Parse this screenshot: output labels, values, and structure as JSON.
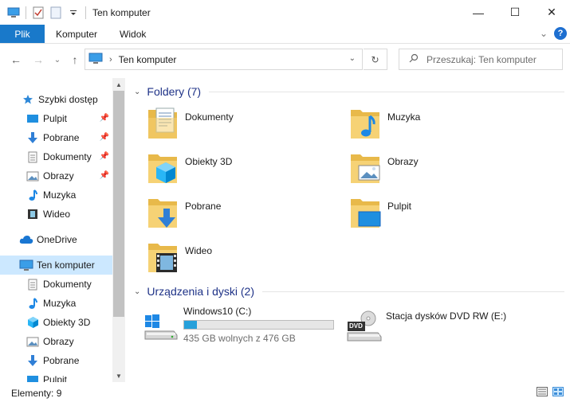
{
  "window": {
    "title": "Ten komputer",
    "min": "—",
    "max": "☐",
    "close": "✕"
  },
  "ribbon": {
    "tabs": [
      "Plik",
      "Komputer",
      "Widok"
    ],
    "collapse": "⌄",
    "help": "?"
  },
  "nav": {
    "back": "←",
    "forward": "→",
    "recent": "⌄",
    "up": "↑",
    "breadcrumb_sep": "›",
    "path": "Ten komputer",
    "dropdown": "⌄",
    "refresh": "↻",
    "search_placeholder": "Przeszukaj: Ten komputer"
  },
  "sidebar": {
    "items": [
      {
        "label": "Szybki dostęp",
        "icon": "star-icon",
        "pinned": false
      },
      {
        "label": "Pulpit",
        "icon": "desktop-icon",
        "pinned": true
      },
      {
        "label": "Pobrane",
        "icon": "download-icon",
        "pinned": true
      },
      {
        "label": "Dokumenty",
        "icon": "document-icon",
        "pinned": true
      },
      {
        "label": "Obrazy",
        "icon": "pictures-icon",
        "pinned": true
      },
      {
        "label": "Muzyka",
        "icon": "music-icon",
        "pinned": false
      },
      {
        "label": "Wideo",
        "icon": "video-icon",
        "pinned": false
      },
      {
        "label": "OneDrive",
        "icon": "cloud-icon",
        "pinned": false
      },
      {
        "label": "Ten komputer",
        "icon": "computer-icon",
        "pinned": false,
        "selected": true
      },
      {
        "label": "Dokumenty",
        "icon": "document-icon",
        "pinned": false
      },
      {
        "label": "Muzyka",
        "icon": "music-icon",
        "pinned": false
      },
      {
        "label": "Obiekty 3D",
        "icon": "cube-icon",
        "pinned": false
      },
      {
        "label": "Obrazy",
        "icon": "pictures-icon",
        "pinned": false
      },
      {
        "label": "Pobrane",
        "icon": "download-icon",
        "pinned": false
      },
      {
        "label": "Pulpit",
        "icon": "desktop-icon",
        "pinned": false
      }
    ]
  },
  "content": {
    "folders_header": "Foldery (7)",
    "folders": [
      {
        "name": "Dokumenty",
        "icon": "documents-folder-icon"
      },
      {
        "name": "Muzyka",
        "icon": "music-folder-icon"
      },
      {
        "name": "Obiekty 3D",
        "icon": "3d-objects-folder-icon"
      },
      {
        "name": "Obrazy",
        "icon": "pictures-folder-icon"
      },
      {
        "name": "Pobrane",
        "icon": "downloads-folder-icon"
      },
      {
        "name": "Pulpit",
        "icon": "desktop-folder-icon"
      },
      {
        "name": "Wideo",
        "icon": "videos-folder-icon"
      }
    ],
    "drives_header": "Urządzenia i dyski (2)",
    "drives": [
      {
        "name": "Windows10 (C:)",
        "free": "435 GB wolnych z 476 GB",
        "used_fraction": 0.086,
        "icon": "windows-drive-icon"
      },
      {
        "name": "Stacja dysków DVD RW (E:)",
        "icon": "dvd-drive-icon",
        "badge": "DVD"
      }
    ]
  },
  "status": {
    "items": "Elementy: 9"
  },
  "colors": {
    "accent": "#1979ca",
    "selection": "#cce8ff",
    "group_header": "#1e3287",
    "drive_fill": "#26a0da"
  }
}
